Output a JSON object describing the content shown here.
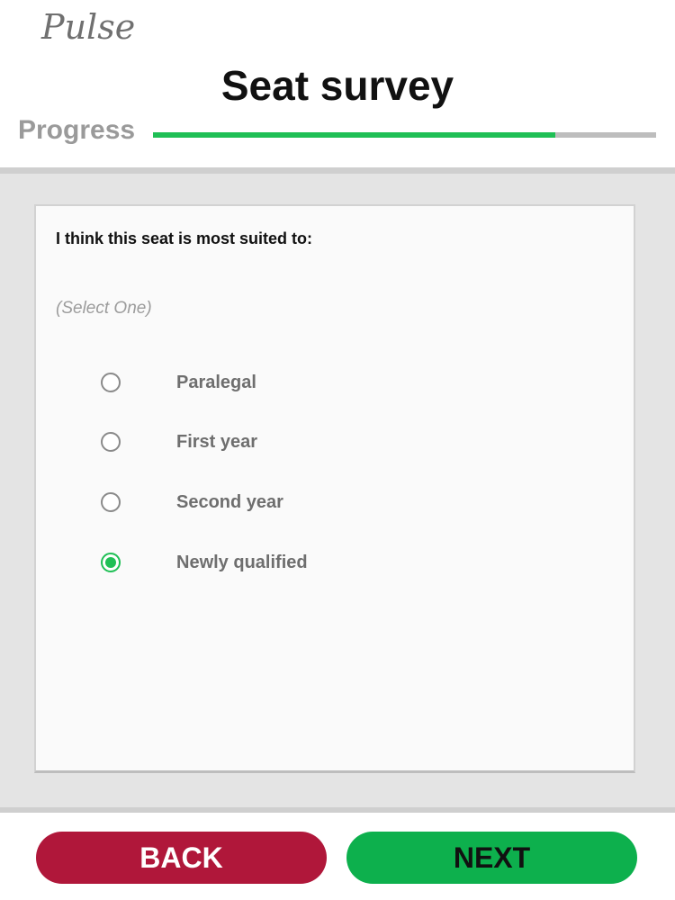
{
  "app": {
    "logo_text": "Pulse"
  },
  "header": {
    "title": "Seat survey",
    "progress_label": "Progress",
    "progress_fraction": 0.8
  },
  "question": {
    "text": "I think this seat is most suited to:",
    "hint": "(Select One)",
    "options": [
      {
        "label": "Paralegal",
        "selected": false
      },
      {
        "label": "First year",
        "selected": false
      },
      {
        "label": "Second year",
        "selected": false
      },
      {
        "label": "Newly qualified",
        "selected": true
      }
    ]
  },
  "footer": {
    "back_label": "BACK",
    "next_label": "NEXT"
  },
  "colors": {
    "accent_green": "#1fbf55",
    "next_button": "#0db04d",
    "back_button": "#b0173a"
  }
}
